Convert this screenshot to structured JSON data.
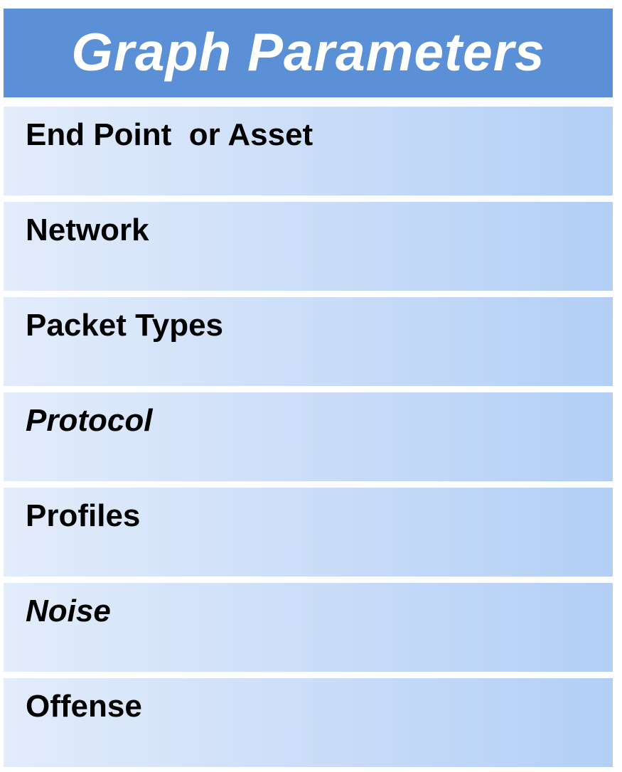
{
  "header": {
    "title": "Graph Parameters",
    "background_color": "#5b8fd6",
    "text_color": "#ffffff"
  },
  "rows": [
    {
      "label": "End Point  or Asset",
      "italic": false
    },
    {
      "label": "Network",
      "italic": false
    },
    {
      "label": "Packet Types",
      "italic": false
    },
    {
      "label": "Protocol",
      "italic": true
    },
    {
      "label": "Profiles",
      "italic": false
    },
    {
      "label": "Noise",
      "italic": true
    },
    {
      "label": "Offense",
      "italic": false
    }
  ],
  "row_gradient_colors": [
    "#e3ecfb",
    "#b3cff6"
  ]
}
